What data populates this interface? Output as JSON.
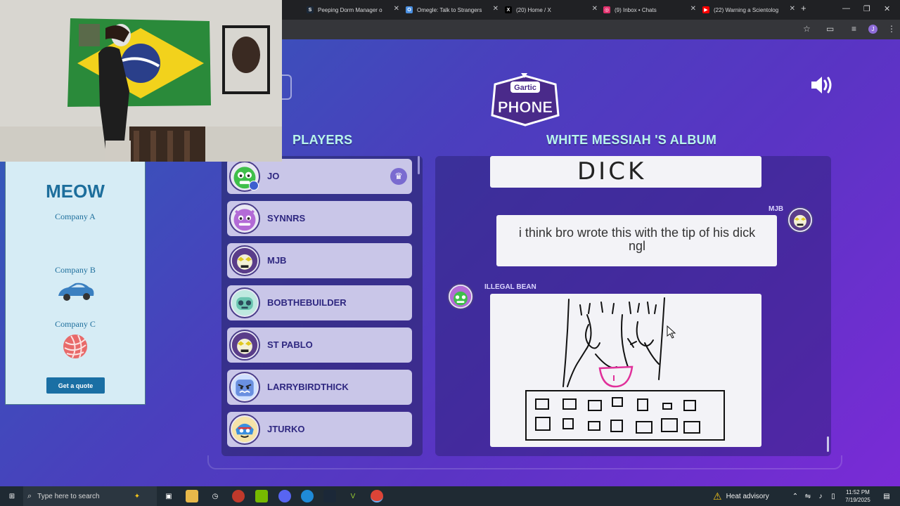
{
  "browser": {
    "tabs": [
      {
        "title": "Peeping Dorm Manager o",
        "icon": "steam-icon",
        "color": "#1b2838"
      },
      {
        "title": "Omegle: Talk to Strangers",
        "icon": "omegle-icon",
        "color": "#4a90e2"
      },
      {
        "title": "(20) Home / X",
        "icon": "x-icon",
        "color": "#000000"
      },
      {
        "title": "(9) Inbox • Chats",
        "icon": "instagram-icon",
        "color": "#e1306c"
      },
      {
        "title": "(22) Warning a Scientolog",
        "icon": "youtube-icon",
        "color": "#ff0000"
      }
    ],
    "profile_initial": "J"
  },
  "game": {
    "players_heading": "PLAYERS",
    "album_heading": "WHITE MESSIAH 'S ALBUM",
    "logo_top": "Gartic",
    "logo_bottom": "PHONE",
    "players": [
      {
        "name": "JO",
        "host": true,
        "avatar_color": "#3fbf4a"
      },
      {
        "name": "SYNNRS",
        "avatar_color": "#b36bd6"
      },
      {
        "name": "MJB",
        "avatar_color": "#5a3d8a"
      },
      {
        "name": "BOBTHEBUILDER",
        "avatar_color": "#6ac4b0"
      },
      {
        "name": "ST PABLO",
        "avatar_color": "#5a3d8a"
      },
      {
        "name": "LARRYBIRDTHICK",
        "avatar_color": "#6a90e0"
      },
      {
        "name": "JTURKO",
        "avatar_color": "#3a8fe0"
      }
    ],
    "album": {
      "entry1_text": "DICK",
      "entry2_author": "MJB",
      "entry2_text": "i think bro wrote this with the tip of his dick ngl",
      "entry3_author": "ILLEGAL BEAN"
    }
  },
  "ad": {
    "title": "MEOW",
    "company_a": "Company A",
    "company_b": "Company B",
    "company_c": "Company C",
    "cta": "Get a quote"
  },
  "taskbar": {
    "search_placeholder": "Type here to search",
    "weather": "Heat advisory",
    "time": "11:52 PM",
    "date": "7/19/2025"
  }
}
